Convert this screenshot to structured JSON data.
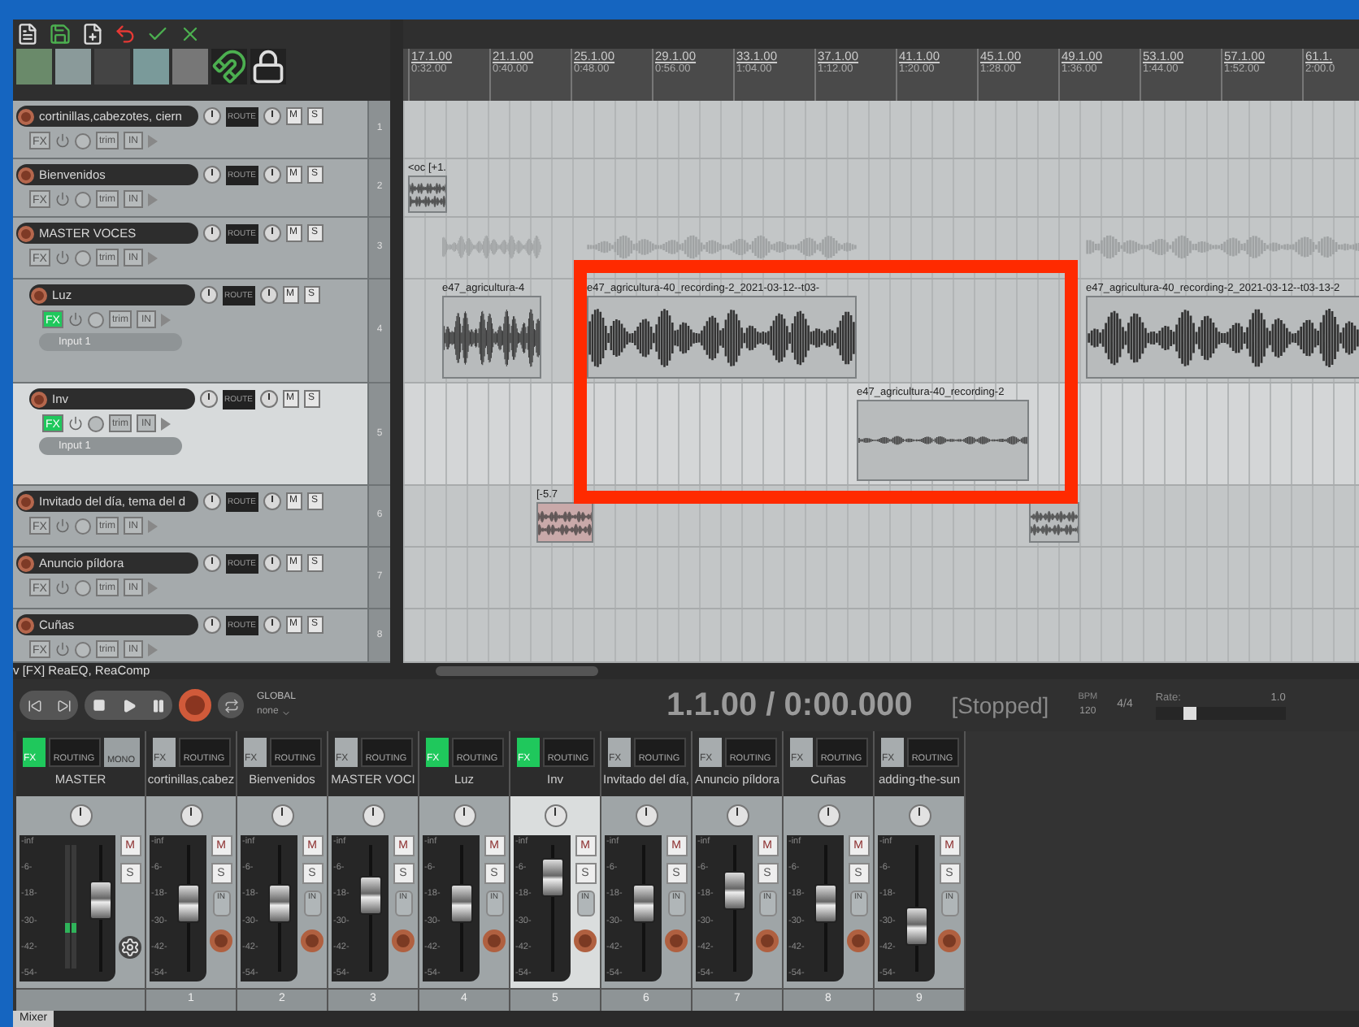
{
  "status_line": "v [FX] ReaEQ, ReaComp",
  "ruler": {
    "marks": [
      {
        "bar": "17.1.00",
        "time": "0:32.00"
      },
      {
        "bar": "21.1.00",
        "time": "0:40.00"
      },
      {
        "bar": "25.1.00",
        "time": "0:48.00"
      },
      {
        "bar": "29.1.00",
        "time": "0:56.00"
      },
      {
        "bar": "33.1.00",
        "time": "1:04.00"
      },
      {
        "bar": "37.1.00",
        "time": "1:12.00"
      },
      {
        "bar": "41.1.00",
        "time": "1:20.00"
      },
      {
        "bar": "45.1.00",
        "time": "1:28.00"
      },
      {
        "bar": "49.1.00",
        "time": "1:36.00"
      },
      {
        "bar": "53.1.00",
        "time": "1:44.00"
      },
      {
        "bar": "57.1.00",
        "time": "1:52.00"
      },
      {
        "bar": "61.1.",
        "time": "2:00.0"
      }
    ]
  },
  "tracks": [
    {
      "name": "cortinillas,cabezotes, ciern",
      "number": "1",
      "selected": false,
      "fx_active": false,
      "route_label": "ROUTE",
      "fx_label": "FX",
      "trim_label": "trim",
      "in_label": "IN",
      "m": "M",
      "s": "S"
    },
    {
      "name": "Bienvenidos",
      "number": "2",
      "selected": false,
      "fx_active": false,
      "route_label": "ROUTE",
      "fx_label": "FX",
      "trim_label": "trim",
      "in_label": "IN",
      "m": "M",
      "s": "S",
      "items": [
        {
          "kind": "stereo",
          "label": "<oc [+1."
        }
      ]
    },
    {
      "name": "MASTER VOCES",
      "number": "3",
      "selected": false,
      "fx_active": false,
      "route_label": "ROUTE",
      "fx_label": "FX",
      "trim_label": "trim",
      "in_label": "IN",
      "m": "M",
      "s": "S",
      "children": [
        {
          "name": "Luz",
          "number": "4",
          "selected": false,
          "fx_active": true,
          "route_label": "ROUTE",
          "fx_label": "FX",
          "trim_label": "trim",
          "in_label": "IN",
          "m": "M",
          "s": "S",
          "input": "Input 1",
          "items": [
            {
              "kind": "mono",
              "label": "e47_agricultura-4"
            },
            {
              "kind": "mono",
              "label": "e47_agricultura-40_recording-2_2021-03-12--t03-"
            },
            {
              "kind": "mono",
              "label": "e47_agricultura-40_recording-2_2021-03-12--t03-13-2"
            }
          ]
        },
        {
          "name": "Inv",
          "number": "5",
          "selected": true,
          "fx_active": true,
          "route_label": "ROUTE",
          "fx_label": "FX",
          "trim_label": "trim",
          "in_label": "IN",
          "m": "M",
          "s": "S",
          "input": "Input 1",
          "items": [
            {
              "kind": "mono",
              "label": "e47_agricultura-40_recording-2"
            }
          ]
        }
      ]
    },
    {
      "name": "Invitado del día, tema del d",
      "number": "6",
      "selected": false,
      "fx_active": false,
      "route_label": "ROUTE",
      "fx_label": "FX",
      "trim_label": "trim",
      "in_label": "IN",
      "m": "M",
      "s": "S",
      "items": [
        {
          "kind": "stereo",
          "label": "[-5.7"
        },
        {
          "kind": "stereo"
        }
      ]
    },
    {
      "name": "Anuncio píldora",
      "number": "7",
      "selected": false,
      "fx_active": false,
      "route_label": "ROUTE",
      "fx_label": "FX",
      "trim_label": "trim",
      "in_label": "IN",
      "m": "M",
      "s": "S"
    },
    {
      "name": "Cuñas",
      "number": "8",
      "selected": false,
      "fx_active": false,
      "route_label": "ROUTE",
      "fx_label": "FX",
      "trim_label": "trim",
      "in_label": "IN",
      "m": "M",
      "s": "S"
    }
  ],
  "transport": {
    "global_label": "GLOBAL",
    "automation_mode": "none",
    "time": "1.1.00 / 0:00.000",
    "state": "[Stopped]",
    "bpm_label": "BPM",
    "bpm": "120",
    "signature": "4/4",
    "rate_label": "Rate:",
    "rate": "1.0",
    "rate_slider": {
      "level": 0.22
    }
  },
  "mixer": {
    "strips": [
      {
        "kind": "master",
        "name": "MASTER",
        "fx_active": true,
        "selected": false,
        "fx_label": "FX",
        "routing_label": "ROUTING",
        "mono_label": "MONO",
        "m": "M",
        "s": "S",
        "level": 0.6,
        "scale": [
          "-inf",
          "-6-",
          "-18-",
          "-30-",
          "-42-",
          "-54-"
        ]
      },
      {
        "kind": "track",
        "name": "cortinillas,cabez",
        "number": "1",
        "fx_active": false,
        "selected": false,
        "fx_label": "FX",
        "routing_label": "ROUTING",
        "m": "M",
        "s": "S",
        "in_label": "IN",
        "level": 0.55,
        "scale": [
          "-inf",
          "-6-",
          "-18-",
          "-30-",
          "-42-",
          "-54-"
        ]
      },
      {
        "kind": "track",
        "name": "Bienvenidos",
        "number": "2",
        "fx_active": false,
        "selected": false,
        "fx_label": "FX",
        "routing_label": "ROUTING",
        "m": "M",
        "s": "S",
        "in_label": "IN",
        "level": 0.55,
        "scale": [
          "-inf",
          "-6-",
          "-18-",
          "-30-",
          "-42-",
          "-54-"
        ]
      },
      {
        "kind": "track",
        "name": "MASTER VOCI",
        "number": "3",
        "fx_active": false,
        "selected": false,
        "fx_label": "FX",
        "routing_label": "ROUTING",
        "m": "M",
        "s": "S",
        "in_label": "IN",
        "level": 0.65,
        "scale": [
          "-inf",
          "-6-",
          "-18-",
          "-30-",
          "-42-",
          "-54-"
        ]
      },
      {
        "kind": "track",
        "name": "Luz",
        "number": "4",
        "fx_active": true,
        "selected": false,
        "fx_label": "FX",
        "routing_label": "ROUTING",
        "m": "M",
        "s": "S",
        "in_label": "IN",
        "level": 0.55,
        "scale": [
          "-inf",
          "-6-",
          "-18-",
          "-30-",
          "-42-",
          "-54-"
        ]
      },
      {
        "kind": "track",
        "name": "Inv",
        "number": "5",
        "fx_active": true,
        "selected": true,
        "fx_label": "FX",
        "routing_label": "ROUTING",
        "m": "M",
        "s": "S",
        "in_label": "IN",
        "level": 0.85,
        "scale": [
          "-inf",
          "-6-",
          "-18-",
          "-30-",
          "-42-",
          "-54-"
        ]
      },
      {
        "kind": "track",
        "name": "Invitado del día,",
        "number": "6",
        "fx_active": false,
        "selected": false,
        "fx_label": "FX",
        "routing_label": "ROUTING",
        "m": "M",
        "s": "S",
        "in_label": "IN",
        "level": 0.55,
        "scale": [
          "-inf",
          "-6-",
          "-18-",
          "-30-",
          "-42-",
          "-54-"
        ]
      },
      {
        "kind": "track",
        "name": "Anuncio píldora",
        "number": "7",
        "fx_active": false,
        "selected": false,
        "fx_label": "FX",
        "routing_label": "ROUTING",
        "m": "M",
        "s": "S",
        "in_label": "IN",
        "level": 0.7,
        "scale": [
          "-inf",
          "-6-",
          "-18-",
          "-30-",
          "-42-",
          "-54-"
        ]
      },
      {
        "kind": "track",
        "name": "Cuñas",
        "number": "8",
        "fx_active": false,
        "selected": false,
        "fx_label": "FX",
        "routing_label": "ROUTING",
        "m": "M",
        "s": "S",
        "in_label": "IN",
        "level": 0.55,
        "scale": [
          "-inf",
          "-6-",
          "-18-",
          "-30-",
          "-42-",
          "-54-"
        ]
      },
      {
        "kind": "track",
        "name": "adding-the-sun",
        "number": "9",
        "fx_active": false,
        "selected": false,
        "fx_label": "FX",
        "routing_label": "ROUTING",
        "m": "M",
        "s": "S",
        "in_label": "IN",
        "level": 0.3,
        "scale": [
          "-inf",
          "-6-",
          "-18-",
          "-30-",
          "-42-",
          "-54-"
        ]
      }
    ]
  },
  "bottom_tab": "Mixer"
}
